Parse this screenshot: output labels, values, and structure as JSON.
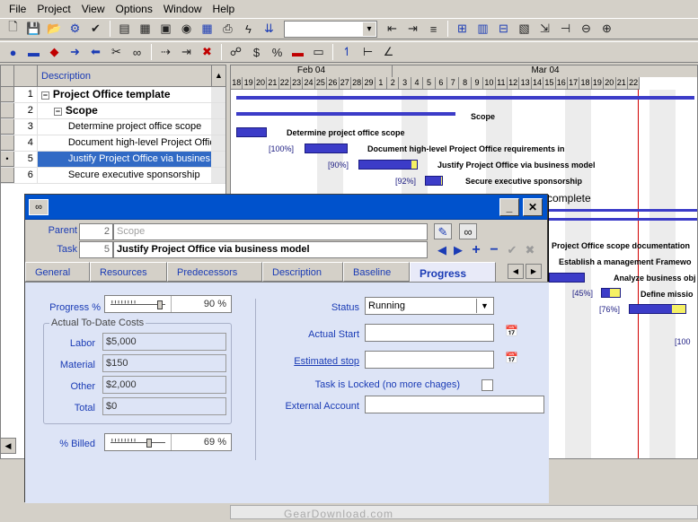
{
  "menu": [
    "File",
    "Project",
    "View",
    "Options",
    "Window",
    "Help"
  ],
  "grid": {
    "header_description": "Description",
    "rows": [
      {
        "num": "1",
        "desc": "Project Office template",
        "level": 0,
        "expander": "−",
        "bold": true,
        "selected": false,
        "marker": ""
      },
      {
        "num": "2",
        "desc": "Scope",
        "level": 1,
        "expander": "−",
        "bold": true,
        "selected": false,
        "marker": ""
      },
      {
        "num": "3",
        "desc": "Determine project office scope",
        "level": 2,
        "expander": "",
        "bold": false,
        "selected": false,
        "marker": ""
      },
      {
        "num": "4",
        "desc": "Document high-level Project Offic",
        "level": 2,
        "expander": "",
        "bold": false,
        "selected": false,
        "marker": ""
      },
      {
        "num": "5",
        "desc": "Justify Project Office via busines",
        "level": 2,
        "expander": "",
        "bold": false,
        "selected": true,
        "marker": "•"
      },
      {
        "num": "6",
        "desc": "Secure executive sponsorship",
        "level": 2,
        "expander": "",
        "bold": false,
        "selected": false,
        "marker": ""
      }
    ]
  },
  "gantt": {
    "months": [
      "Feb 04",
      "Mar 04"
    ],
    "days": [
      "18",
      "19",
      "20",
      "21",
      "22",
      "23",
      "24",
      "25",
      "26",
      "27",
      "28",
      "29",
      "1",
      "2",
      "3",
      "4",
      "5",
      "6",
      "7",
      "8",
      "9",
      "10",
      "11",
      "12",
      "13",
      "14",
      "15",
      "16",
      "17",
      "18",
      "19",
      "20",
      "21",
      "22"
    ],
    "labels": {
      "scope": "Scope",
      "t3": "Determine project office scope",
      "t4": "Document high-level Project Office requirements in",
      "t5": "Justify Project Office via business model",
      "t6": "Secure executive sponsorship",
      "complete": "complete",
      "doc": "Project Office scope documentation",
      "fw": "Establish a management Framewo",
      "analyze": "Analyze business obj",
      "define": "Define missio"
    },
    "pcts": {
      "p4": "[100%]",
      "p5": "[90%]",
      "p6": "[92%]",
      "p45": "[45%]",
      "p76": "[76%]",
      "p100b": "[100"
    },
    "progress": {
      "t4": 1.0,
      "t5": 0.9,
      "t6": 0.92,
      "analyze": 0.45,
      "define": 0.76
    }
  },
  "watermark": "GearDownload.com",
  "dialog": {
    "parent_label": "Parent",
    "parent_num": "2",
    "parent_value": "Scope",
    "task_label": "Task",
    "task_num": "5",
    "task_value": "Justify Project Office via business model",
    "tabs": [
      "General",
      "Resources",
      "Predecessors",
      "Description",
      "Baseline",
      "Progress"
    ],
    "active_tab": "Progress",
    "progress": {
      "progress_label": "Progress %",
      "progress_value": "90 %",
      "progress_fraction": 0.9,
      "costs_legend": "Actual To-Date Costs",
      "costs": [
        {
          "label": "Labor",
          "value": "$5,000"
        },
        {
          "label": "Material",
          "value": "$150"
        },
        {
          "label": "Other",
          "value": "$2,000"
        },
        {
          "label": "Total",
          "value": "$0"
        }
      ],
      "billed_label": "% Billed",
      "billed_value": "69 %",
      "billed_fraction": 0.69,
      "status_label": "Status",
      "status_value": "Running",
      "actual_start_label": "Actual Start",
      "actual_start_value": "",
      "est_stop_label": "Estimated stop",
      "est_stop_value": "",
      "locked_label": "Task is Locked  (no more chages)",
      "ext_account_label": "External Account",
      "ext_account_value": ""
    }
  },
  "colors": {
    "selection": "#316ac5",
    "titlebar": "#0052cc",
    "label_blue": "#1a3bb5",
    "gantt_bar": "#3c3cc8",
    "gantt_remaining": "#f5f064",
    "today_line": "#d00000"
  }
}
